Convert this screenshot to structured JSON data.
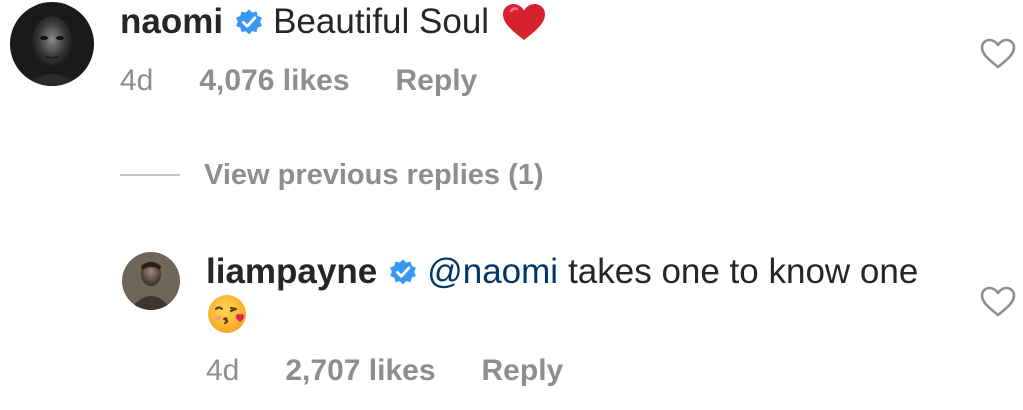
{
  "comment": {
    "username": "naomi",
    "text": "Beautiful Soul",
    "emoji_icon": "red-heart-emoji",
    "time": "4d",
    "likes": "4,076 likes",
    "reply_label": "Reply",
    "verified": true
  },
  "view_replies": {
    "label": "View previous replies (1)"
  },
  "reply": {
    "username": "liampayne",
    "mention": "@naomi",
    "text": "takes one to know one",
    "emoji_icon": "face-blowing-kiss-emoji",
    "time": "4d",
    "likes": "2,707 likes",
    "reply_label": "Reply",
    "verified": true
  },
  "colors": {
    "text": "#262626",
    "muted": "#8e8e8e",
    "verified_blue": "#3897f0",
    "heart_red": "#d6222f",
    "mention": "#00376b"
  }
}
